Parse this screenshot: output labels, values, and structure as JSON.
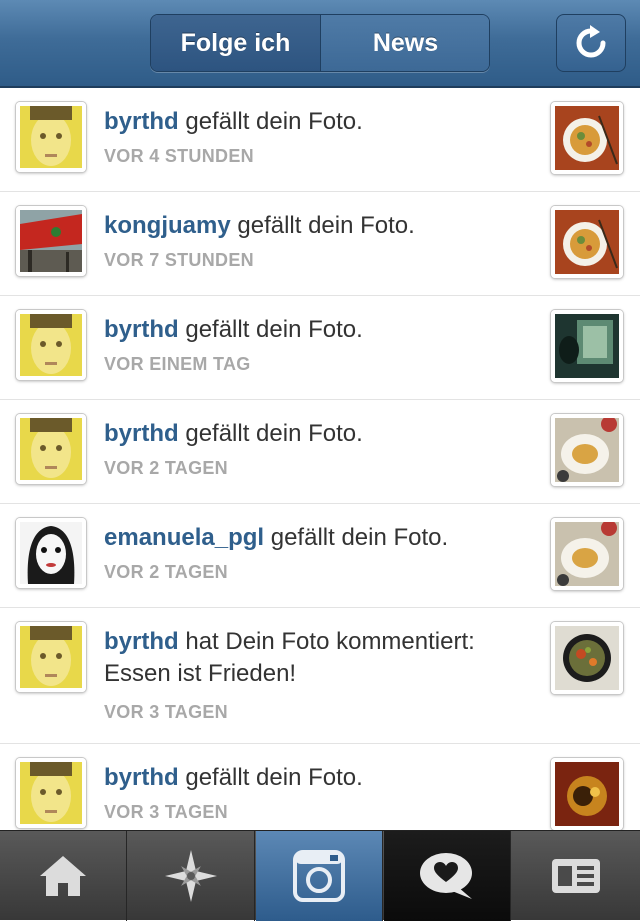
{
  "header": {
    "tab_following": "Folge ich",
    "tab_news": "News",
    "refresh_icon": "refresh-icon"
  },
  "colors": {
    "header_blue": "#3f6c98",
    "username_blue": "#2f5f8c",
    "timestamp_grey": "#a8a8a8",
    "tab_active": "#3d6996"
  },
  "news": [
    {
      "user": "byrthd",
      "action": " gefällt dein Foto.",
      "time": "VOR 4 STUNDEN"
    },
    {
      "user": "kongjuamy",
      "action": " gefällt dein Foto.",
      "time": "VOR 7 STUNDEN"
    },
    {
      "user": "byrthd",
      "action": " gefällt dein Foto.",
      "time": "VOR EINEM TAG"
    },
    {
      "user": "byrthd",
      "action": " gefällt dein Foto.",
      "time": "VOR 2 TAGEN"
    },
    {
      "user": "emanuela_pgl",
      "action": " gefällt dein Foto.",
      "time": "VOR 2 TAGEN"
    },
    {
      "user": "byrthd",
      "action": " hat Dein Foto kommentiert: Essen ist Frieden!",
      "time": "VOR 3 TAGEN"
    },
    {
      "user": "byrthd",
      "action": " gefällt dein Foto.",
      "time": "VOR 3 TAGEN"
    }
  ],
  "tabbar": {
    "items": [
      "home-icon",
      "explore-icon",
      "camera-icon",
      "news-icon",
      "profile-icon"
    ],
    "active": "camera-icon"
  }
}
